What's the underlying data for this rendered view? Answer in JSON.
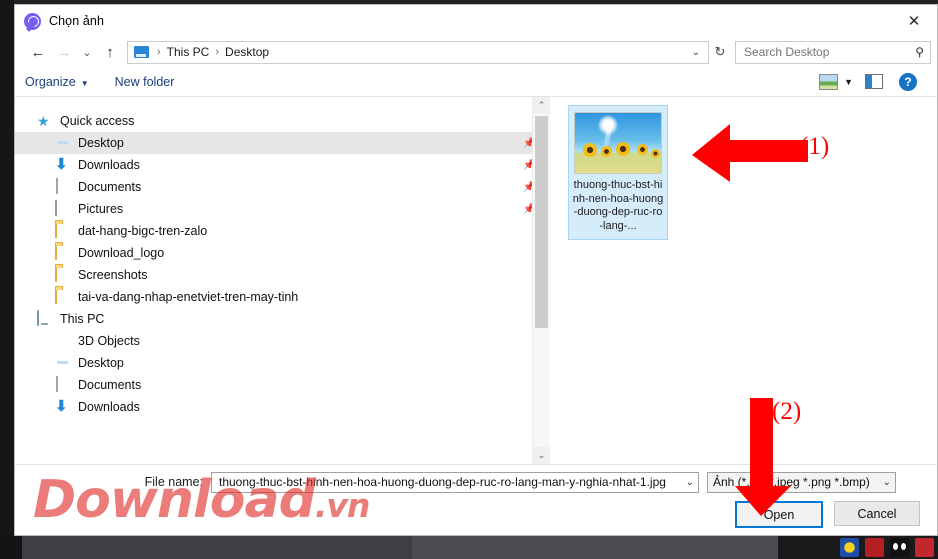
{
  "window": {
    "title": "Chọn ảnh",
    "app_icon": "viber-icon",
    "close_label": "✕"
  },
  "nav": {
    "back": "←",
    "forward": "→",
    "recent_caret": "⌄",
    "up": "↑",
    "breadcrumb": [
      "This PC",
      "Desktop"
    ],
    "breadcrumb_sep": "›",
    "breadcrumb_caret": "⌄",
    "refresh": "↻"
  },
  "search": {
    "placeholder": "Search Desktop",
    "value": "",
    "icon": "search-icon"
  },
  "commandbar": {
    "organize": "Organize",
    "organize_caret": "▼",
    "new_folder": "New folder",
    "view_caret": "▼",
    "help": "?"
  },
  "sidebar": {
    "items": [
      {
        "label": "Quick access",
        "icon": "star-icon",
        "indent": 0,
        "selected": false,
        "pinned": false
      },
      {
        "label": "Desktop",
        "icon": "monitor-icon",
        "indent": 1,
        "selected": true,
        "pinned": true
      },
      {
        "label": "Downloads",
        "icon": "download-arrow-icon",
        "indent": 1,
        "selected": false,
        "pinned": true
      },
      {
        "label": "Documents",
        "icon": "document-icon",
        "indent": 1,
        "selected": false,
        "pinned": true
      },
      {
        "label": "Pictures",
        "icon": "pictures-icon",
        "indent": 1,
        "selected": false,
        "pinned": true
      },
      {
        "label": "dat-hang-bigc-tren-zalo",
        "icon": "folder-icon",
        "indent": 1,
        "selected": false,
        "pinned": false
      },
      {
        "label": "Download_logo",
        "icon": "folder-icon",
        "indent": 1,
        "selected": false,
        "pinned": false
      },
      {
        "label": "Screenshots",
        "icon": "folder-icon",
        "indent": 1,
        "selected": false,
        "pinned": false
      },
      {
        "label": "tai-va-dang-nhap-enetviet-tren-may-tinh",
        "icon": "folder-icon",
        "indent": 1,
        "selected": false,
        "pinned": false
      },
      {
        "label": "This PC",
        "icon": "this-pc-icon",
        "indent": 0,
        "selected": false,
        "pinned": false
      },
      {
        "label": "3D Objects",
        "icon": "3d-objects-icon",
        "indent": 1,
        "selected": false,
        "pinned": false
      },
      {
        "label": "Desktop",
        "icon": "monitor-icon",
        "indent": 1,
        "selected": false,
        "pinned": false
      },
      {
        "label": "Documents",
        "icon": "document-icon",
        "indent": 1,
        "selected": false,
        "pinned": false
      },
      {
        "label": "Downloads",
        "icon": "download-arrow-icon",
        "indent": 1,
        "selected": false,
        "pinned": false
      }
    ],
    "scroll_up": "⌃",
    "scroll_down": "⌄"
  },
  "files": [
    {
      "name": "thuong-thuc-bst-hinh-nen-hoa-huong-duong-dep-ruc-ro-lang-...",
      "selected": true,
      "thumbnail": "sunflower-field-photo"
    }
  ],
  "footer": {
    "filename_label": "File name:",
    "filename_value": "thuong-thuc-bst-hinh-nen-hoa-huong-duong-dep-ruc-ro-lang-man-y-nghia-nhat-1.jpg",
    "filetype_value": "Ảnh (*.jpg *.jpeg *.png *.bmp)",
    "dropdown_caret": "⌄",
    "open_button": "Open",
    "cancel_button": "Cancel"
  },
  "annotations": [
    {
      "id": "step-1",
      "label": "(1)",
      "shape": "left-arrow",
      "color": "#ff0000"
    },
    {
      "id": "step-2",
      "label": "(2)",
      "shape": "down-arrow",
      "color": "#ff0000"
    }
  ],
  "watermark": {
    "text": "Download",
    "suffix": ".vn",
    "color": "#de2c26"
  },
  "colors": {
    "accent": "#0078d7",
    "selection": "#d5ecfb",
    "link_text": "#1c3f7c",
    "annotation": "#ff0000"
  }
}
